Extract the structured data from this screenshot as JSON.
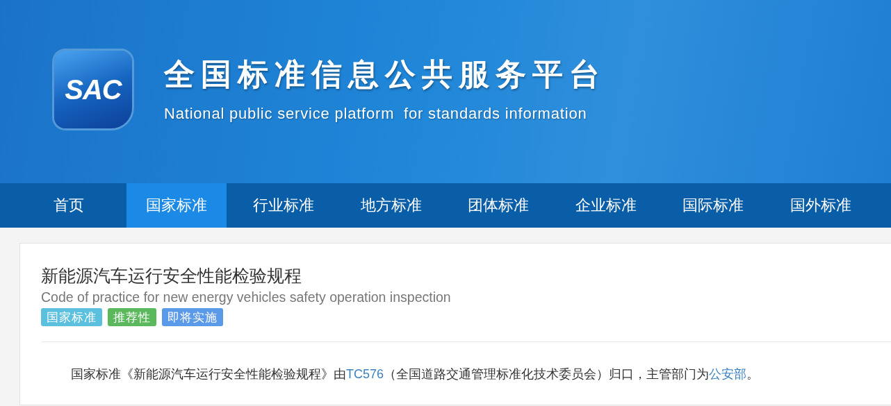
{
  "header": {
    "logo_text": "SAC",
    "title": "全国标准信息公共服务平台",
    "subtitle": "National public service platform  for standards information"
  },
  "nav": [
    {
      "label": "首页",
      "selected": false
    },
    {
      "label": "国家标准",
      "selected": true
    },
    {
      "label": "行业标准",
      "selected": false
    },
    {
      "label": "地方标准",
      "selected": false
    },
    {
      "label": "团体标准",
      "selected": false
    },
    {
      "label": "企业标准",
      "selected": false
    },
    {
      "label": "国际标准",
      "selected": false
    },
    {
      "label": "国外标准",
      "selected": false
    }
  ],
  "standard": {
    "title": "新能源汽车运行安全性能检验规程",
    "title_en": "Code of practice for new energy vehicles safety operation inspection",
    "tags": [
      {
        "label": "国家标准",
        "color": "#5bc0de"
      },
      {
        "label": "推荐性",
        "color": "#5cb85c"
      },
      {
        "label": "即将实施",
        "color": "#5b9ae8"
      }
    ],
    "description": [
      {
        "kind": "text",
        "text": "国家标准《新能源汽车运行安全性能检验规程》由"
      },
      {
        "kind": "link",
        "text": "TC576"
      },
      {
        "kind": "text",
        "text": "（全国道路交通管理标准化技术委员会）归口，主管部门为"
      },
      {
        "kind": "link",
        "text": "公安部"
      },
      {
        "kind": "text",
        "text": "。"
      }
    ]
  }
}
